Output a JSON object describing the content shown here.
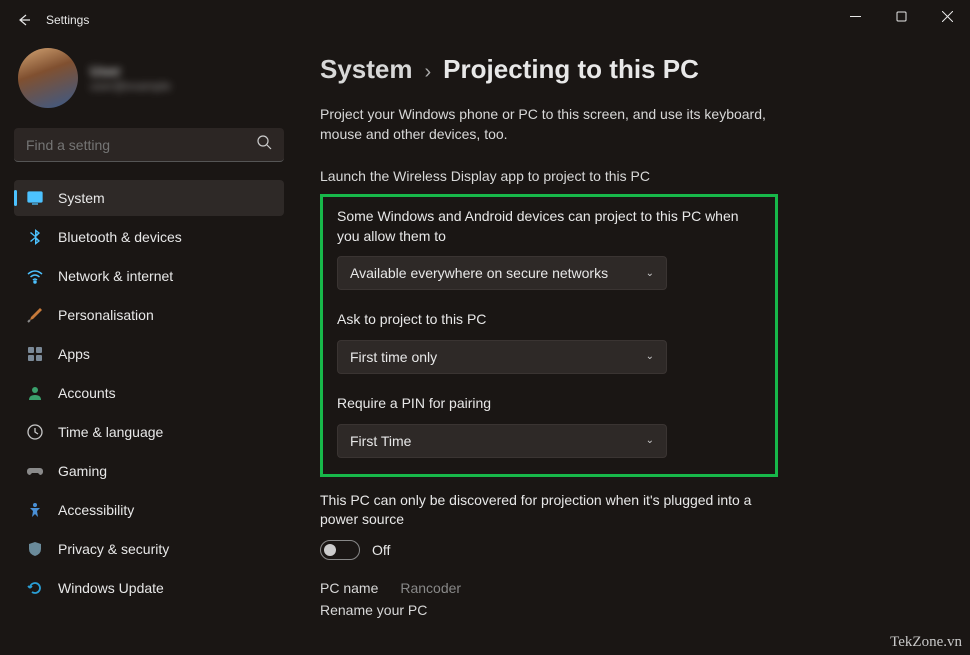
{
  "window": {
    "title": "Settings"
  },
  "user": {
    "name": "User",
    "email": "user@example"
  },
  "search": {
    "placeholder": "Find a setting"
  },
  "sidebar": {
    "items": [
      {
        "label": "System"
      },
      {
        "label": "Bluetooth & devices"
      },
      {
        "label": "Network & internet"
      },
      {
        "label": "Personalisation"
      },
      {
        "label": "Apps"
      },
      {
        "label": "Accounts"
      },
      {
        "label": "Time & language"
      },
      {
        "label": "Gaming"
      },
      {
        "label": "Accessibility"
      },
      {
        "label": "Privacy & security"
      },
      {
        "label": "Windows Update"
      }
    ]
  },
  "breadcrumb": {
    "parent": "System",
    "current": "Projecting to this PC"
  },
  "description": "Project your Windows phone or PC to this screen, and use its keyboard, mouse and other devices, too.",
  "launch_text": "Launch the Wireless Display app to project to this PC",
  "settings": [
    {
      "label": "Some Windows and Android devices can project to this PC when you allow them to",
      "value": "Available everywhere on secure networks"
    },
    {
      "label": "Ask to project to this PC",
      "value": "First time only"
    },
    {
      "label": "Require a PIN for pairing",
      "value": "First Time"
    }
  ],
  "discovery": {
    "label": "This PC can only be discovered for projection when it's plugged into a power source",
    "state": "Off"
  },
  "pc_name": {
    "label": "PC name",
    "value": "Rancoder"
  },
  "rename_link": "Rename your PC",
  "watermark": "TekZone.vn"
}
